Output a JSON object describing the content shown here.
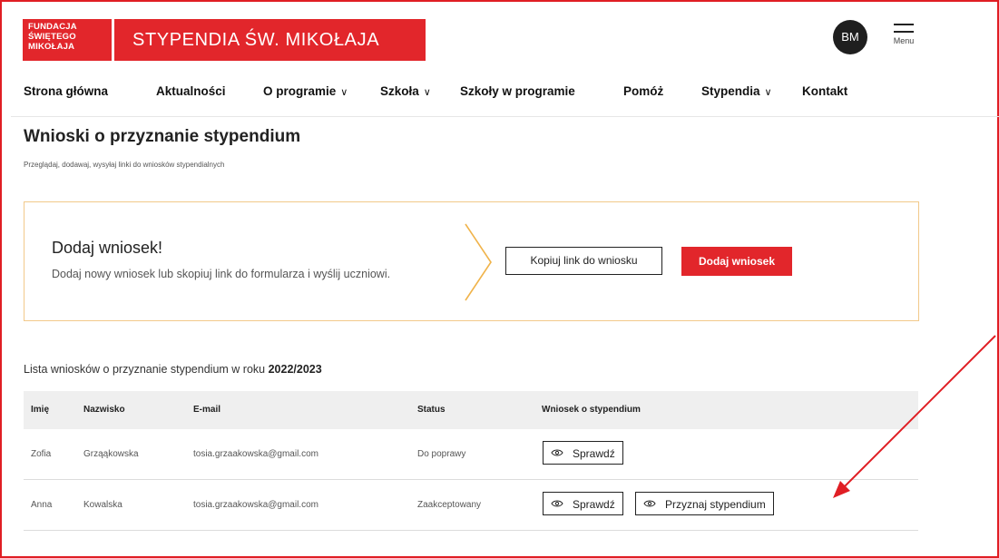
{
  "header": {
    "logo_lines": [
      "FUNDACJA",
      "ŚWIĘTEGO",
      "MIKOŁAJA"
    ],
    "brand": "STYPENDIA ŚW. MIKOŁAJA",
    "avatar": "BM",
    "menu_label": "Menu"
  },
  "nav": {
    "items": [
      {
        "label": "Strona główna",
        "dropdown": false
      },
      {
        "label": "Aktualności",
        "dropdown": false
      },
      {
        "label": "O programie",
        "dropdown": true
      },
      {
        "label": "Szkoła",
        "dropdown": true
      },
      {
        "label": "Szkoły w programie",
        "dropdown": false
      },
      {
        "label": "Pomóż",
        "dropdown": false
      },
      {
        "label": "Stypendia",
        "dropdown": true
      },
      {
        "label": "Kontakt",
        "dropdown": false
      }
    ]
  },
  "page": {
    "title": "Wnioski o przyznanie stypendium",
    "subtitle": "Przeglądaj, dodawaj, wysyłaj linki do wniosków stypendialnych"
  },
  "promo": {
    "title": "Dodaj wniosek!",
    "description": "Dodaj nowy wniosek lub skopiuj link do formularza i wyślij uczniowi.",
    "copy_link_label": "Kopiuj link do wniosku",
    "add_label": "Dodaj wniosek"
  },
  "list": {
    "caption_prefix": "Lista wniosków o przyznanie stypendium w roku",
    "year": "2022/2023",
    "columns": [
      "Imię",
      "Nazwisko",
      "E-mail",
      "Status",
      "Wniosek o stypendium"
    ],
    "rows": [
      {
        "first_name": "Zofia",
        "last_name": "Grząąkowska",
        "email": "tosia.grzaakowska@gmail.com",
        "status": "Do poprawy",
        "actions": [
          "Sprawdź"
        ]
      },
      {
        "first_name": "Anna",
        "last_name": "Kowalska",
        "email": "tosia.grzaakowska@gmail.com",
        "status": "Zaakceptowany",
        "actions": [
          "Sprawdź",
          "Przyznaj stypendium"
        ]
      }
    ]
  },
  "icons": {
    "action_icon": "eye-icon",
    "menu_icon": "hamburger-icon",
    "promo_divider": "chevron-right-icon"
  },
  "colors": {
    "brand_red": "#e2262b",
    "promo_border": "#f2c98a",
    "promo_arrow": "#f0b34a",
    "annotation_red": "#e01e24"
  }
}
